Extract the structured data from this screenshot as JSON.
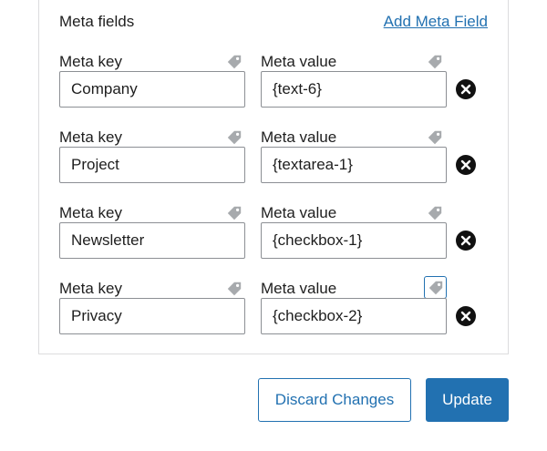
{
  "meta_section": {
    "title": "Meta fields",
    "add_link": "Add Meta Field"
  },
  "rows": [
    {
      "key_label": "Meta key",
      "value_label": "Meta value",
      "key": "Company",
      "value": "{text-6}"
    },
    {
      "key_label": "Meta key",
      "value_label": "Meta value",
      "key": "Project",
      "value": "{textarea-1}"
    },
    {
      "key_label": "Meta key",
      "value_label": "Meta value",
      "key": "Newsletter",
      "value": "{checkbox-1}"
    },
    {
      "key_label": "Meta key",
      "value_label": "Meta value",
      "key": "Privacy",
      "value": "{checkbox-2}"
    }
  ],
  "buttons": {
    "discard": "Discard Changes",
    "update": "Update"
  },
  "icons": {
    "tag": "tag-icon",
    "remove": "remove-circle-icon"
  },
  "colors": {
    "accent": "#2271b1",
    "tag_icon": "#a7aaad"
  }
}
